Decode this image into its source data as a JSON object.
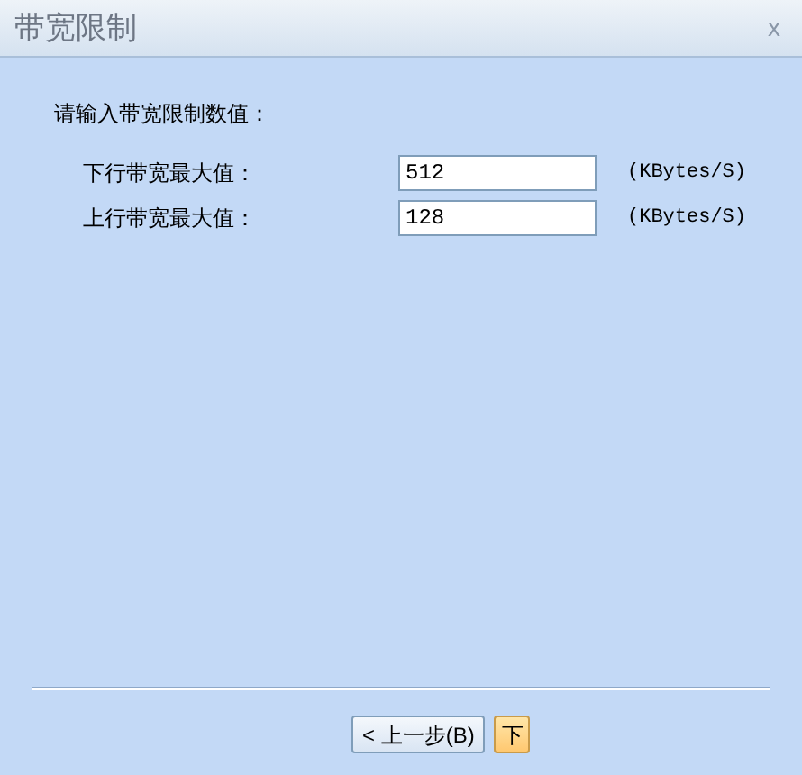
{
  "window": {
    "title": "带宽限制",
    "close": "x"
  },
  "prompt": "请输入带宽限制数值：",
  "fields": [
    {
      "label": "下行带宽最大值：",
      "value": "512",
      "unit": "(KBytes/S)"
    },
    {
      "label": "上行带宽最大值：",
      "value": "128",
      "unit": "(KBytes/S)"
    }
  ],
  "buttons": [
    {
      "label": "< 上一步(B)",
      "kind": "normal"
    },
    {
      "label": "下",
      "kind": "default"
    }
  ]
}
